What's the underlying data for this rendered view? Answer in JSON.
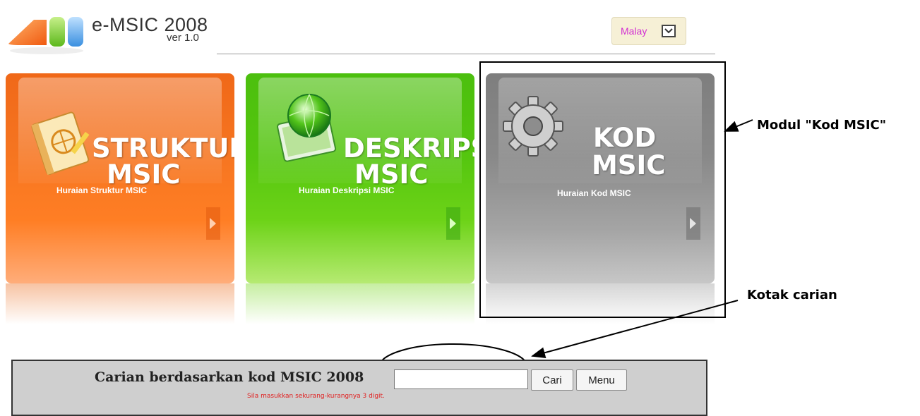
{
  "header": {
    "app_title": "e-MSIC 2008",
    "version": "ver 1.0",
    "language_selected": "Malay"
  },
  "tiles": [
    {
      "line1": "STRUKTUR",
      "line2": "MSIC",
      "subtitle": "Huraian Struktur MSIC",
      "icon": "notebook-icon"
    },
    {
      "line1": "DESKRIPSI",
      "line2": "MSIC",
      "subtitle": "Huraian Deskripsi MSIC",
      "icon": "globe-monitor-icon"
    },
    {
      "line1": "KOD",
      "line2": "MSIC",
      "subtitle": "Huraian Kod MSIC",
      "icon": "gear-icon"
    }
  ],
  "annotations": {
    "module_label": "Modul \"Kod MSIC\"",
    "search_box_label": "Kotak carian"
  },
  "search": {
    "label": "Carian berdasarkan kod MSIC 2008",
    "input_value": "",
    "search_button": "Cari",
    "menu_button": "Menu",
    "hint": "Sila masukkan sekurang-kurangnya 3 digit."
  },
  "colors": {
    "orange": "#f57420",
    "green": "#55c60f",
    "gray": "#898989",
    "lang_text": "#d22fd2",
    "hint_text": "#e02020"
  }
}
